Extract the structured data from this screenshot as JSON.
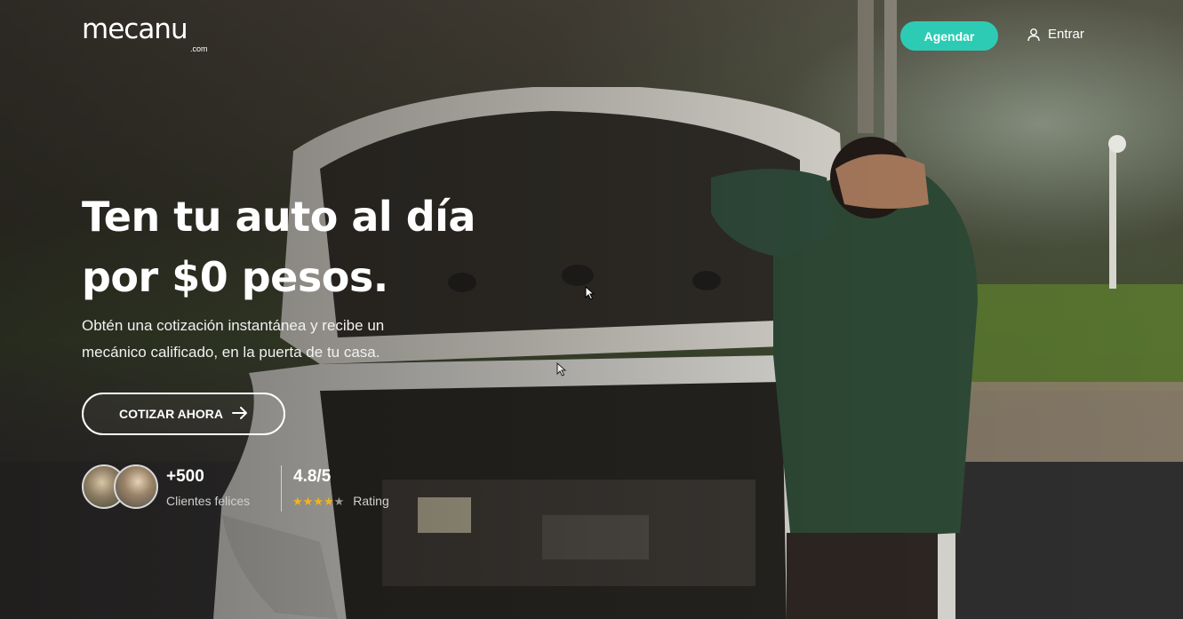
{
  "header": {
    "logo_text": "mecanu",
    "logo_suffix": ".com",
    "schedule_label": "Agendar",
    "login_label": "Entrar"
  },
  "hero": {
    "headline_line1": "Ten tu auto al día",
    "headline_line2": "por $0 pesos.",
    "subtitle_line1": "Obtén una cotización instantánea y recibe un",
    "subtitle_line2": "mecánico calificado, en la puerta de tu casa.",
    "cta_label": "COTIZAR AHORA"
  },
  "stats": {
    "clients_count": "+500",
    "clients_label": "Clientes felices",
    "rating_value": "4.8/5",
    "rating_label": "Rating",
    "stars_filled": 4,
    "stars_total": 5
  },
  "colors": {
    "accent": "#2ecbb4",
    "star": "#f2b51c"
  },
  "icons": {
    "login": "user-icon",
    "cta": "arrow-right-icon"
  }
}
